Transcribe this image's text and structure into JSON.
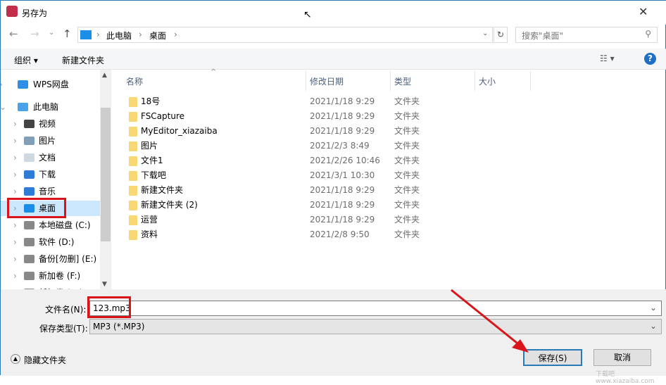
{
  "window": {
    "title": "另存为",
    "close": "✕"
  },
  "addressbar": {
    "crumbs": [
      "此电脑",
      "桌面"
    ],
    "search_placeholder": "搜索\"桌面\"",
    "refresh": "↻"
  },
  "toolbar": {
    "organize": "组织 ▾",
    "new_folder": "新建文件夹",
    "help": "?"
  },
  "nav": [
    {
      "label": "WPS网盘",
      "icon": "cloud-icon",
      "color": "#2f8fe6"
    },
    {
      "label": "此电脑",
      "icon": "computer-icon",
      "color": "#4aa3e8"
    },
    {
      "label": "视频",
      "icon": "film-icon",
      "color": "#444"
    },
    {
      "label": "图片",
      "icon": "picture-icon",
      "color": "#7fa0b8"
    },
    {
      "label": "文档",
      "icon": "document-icon",
      "color": "#cfd8e0"
    },
    {
      "label": "下载",
      "icon": "download-icon",
      "color": "#2e7cd6"
    },
    {
      "label": "音乐",
      "icon": "music-icon",
      "color": "#2e7cd6"
    },
    {
      "label": "桌面",
      "icon": "desktop-icon",
      "color": "#1b8fe8"
    },
    {
      "label": "本地磁盘 (C:)",
      "icon": "drive-icon",
      "color": "#888"
    },
    {
      "label": "软件 (D:)",
      "icon": "drive-icon",
      "color": "#888"
    },
    {
      "label": "备份[勿删] (E:)",
      "icon": "drive-icon",
      "color": "#888"
    },
    {
      "label": "新加卷 (F:)",
      "icon": "drive-icon",
      "color": "#888"
    },
    {
      "label": "新加卷 (G:)",
      "icon": "drive-icon",
      "color": "#888"
    }
  ],
  "columns": {
    "name": "名称",
    "date": "修改日期",
    "type": "类型",
    "size": "大小"
  },
  "files": [
    {
      "name": "18号",
      "date": "2021/1/18 9:29",
      "type": "文件夹"
    },
    {
      "name": "FSCapture",
      "date": "2021/1/18 9:29",
      "type": "文件夹"
    },
    {
      "name": "MyEditor_xiazaiba",
      "date": "2021/1/18 9:29",
      "type": "文件夹"
    },
    {
      "name": "图片",
      "date": "2021/2/3 8:49",
      "type": "文件夹"
    },
    {
      "name": "文件1",
      "date": "2021/2/26 10:46",
      "type": "文件夹"
    },
    {
      "name": "下载吧",
      "date": "2021/3/1 10:30",
      "type": "文件夹"
    },
    {
      "name": "新建文件夹",
      "date": "2021/1/18 9:29",
      "type": "文件夹"
    },
    {
      "name": "新建文件夹 (2)",
      "date": "2021/1/18 9:29",
      "type": "文件夹"
    },
    {
      "name": "运营",
      "date": "2021/1/18 9:29",
      "type": "文件夹"
    },
    {
      "name": "资料",
      "date": "2021/2/8 9:50",
      "type": "文件夹"
    }
  ],
  "form": {
    "filename_label": "文件名(N):",
    "filename_value": "123.mp3",
    "type_label": "保存类型(T):",
    "type_value": "MP3 (*.MP3)"
  },
  "footer": {
    "hide_folders": "隐藏文件夹",
    "save": "保存(S)",
    "cancel": "取消"
  },
  "watermark": "下载吧 www.xiazaiba.com"
}
